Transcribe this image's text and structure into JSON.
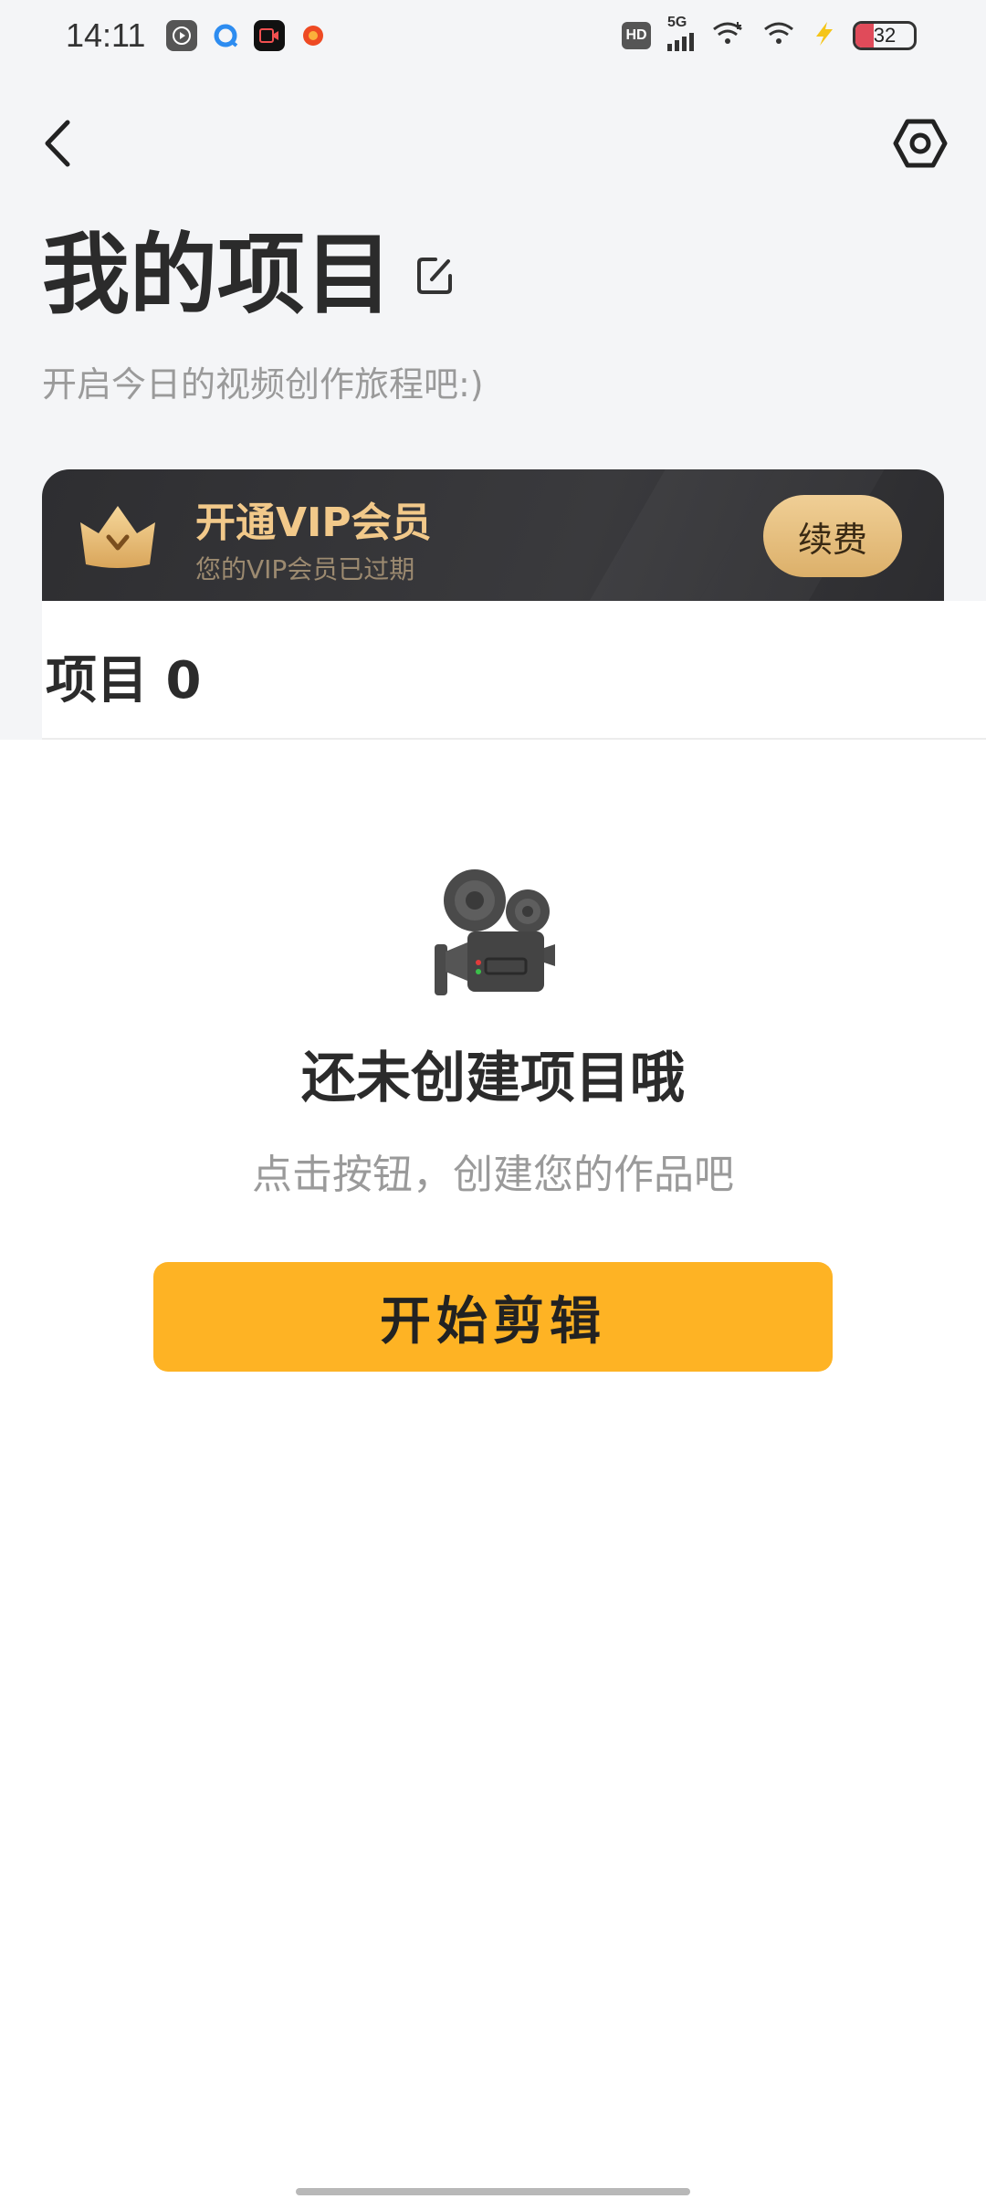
{
  "status_bar": {
    "time": "14:11",
    "network": "5G",
    "hd_label": "HD",
    "battery": "32",
    "battery_level": 0.32,
    "notification_icons": [
      "play-icon",
      "browser-icon",
      "video-record-icon",
      "app-orange-icon"
    ],
    "system_icons": [
      "hd-icon",
      "5g-signal-icon",
      "wifi-plus-icon",
      "wifi-icon",
      "charging-icon",
      "battery-icon"
    ]
  },
  "header": {
    "back_icon": "chevron-left-icon",
    "settings_icon": "hexagon-settings-icon",
    "title": "我的项目",
    "edit_icon": "edit-icon",
    "subtitle": "开启今日的视频创作旅程吧:)"
  },
  "vip": {
    "title": "开通VIP会员",
    "subtitle": "您的VIP会员已过期",
    "renew_label": "续费",
    "icon": "crown-icon",
    "accent_color": "#f2c98a"
  },
  "projects": {
    "heading": "项目 0"
  },
  "empty_state": {
    "icon": "film-camera-icon",
    "title": "还未创建项目哦",
    "subtitle": "点击按钮，创建您的作品吧",
    "start_label": "开始剪辑",
    "button_color": "#feb324"
  }
}
